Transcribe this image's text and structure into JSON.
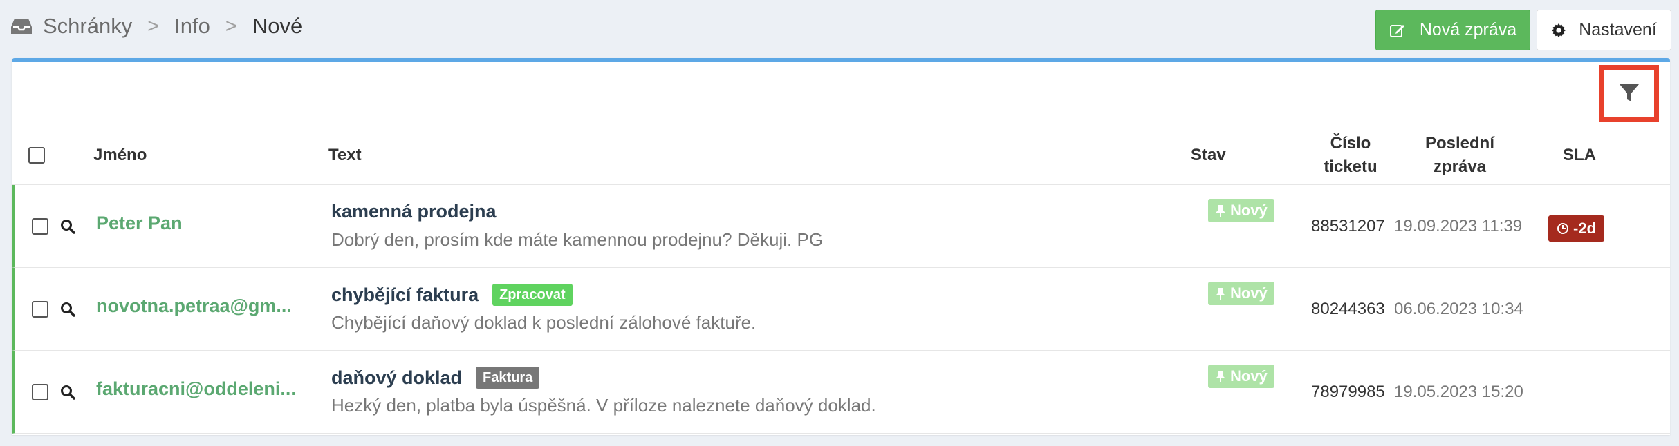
{
  "breadcrumb": {
    "items": [
      "Schránky",
      "Info",
      "Nové"
    ],
    "separator": ">",
    "icon": "inbox-icon"
  },
  "toolbar": {
    "new_message_label": "Nová zpráva",
    "new_message_icon": "edit-icon",
    "settings_label": "Nastavení",
    "settings_icon": "gear-icon",
    "filter_icon": "filter-icon"
  },
  "colors": {
    "accent_bar": "#5da8e6",
    "primary_button": "#5cb85c",
    "highlight_outline": "#e8412c",
    "name_link": "#5ba871",
    "state_badge": "#aee3a7",
    "sla_badge": "#a52a1e"
  },
  "table": {
    "headers": {
      "name": "Jméno",
      "text": "Text",
      "state": "Stav",
      "ticket_line1": "Číslo",
      "ticket_line2": "ticketu",
      "last_line1": "Poslední",
      "last_line2": "zpráva",
      "sla": "SLA"
    },
    "rows": [
      {
        "name": "Peter Pan",
        "subject": "kamenná prodejna",
        "preview": "Dobrý den,  prosím kde máte kamennou prodejnu? Děkuji. PG",
        "state": "Nový",
        "ticket": "88531207",
        "last_message": "19.09.2023 11:39",
        "sla": "-2d"
      },
      {
        "name": "novotna.petraa@gm...",
        "subject": "chybějící faktura",
        "tag": "Zpracovat",
        "preview": "Chybějící daňový doklad k poslední zálohové faktuře.",
        "state": "Nový",
        "ticket": "80244363",
        "last_message": "06.06.2023 10:34"
      },
      {
        "name": "fakturacni@oddeleni...",
        "subject": "daňový doklad",
        "tag": "Faktura",
        "preview": "Hezký den, platba byla úspěšná. V příloze naleznete daňový doklad.",
        "state": "Nový",
        "ticket": "78979985",
        "last_message": "19.05.2023 15:20"
      }
    ]
  }
}
